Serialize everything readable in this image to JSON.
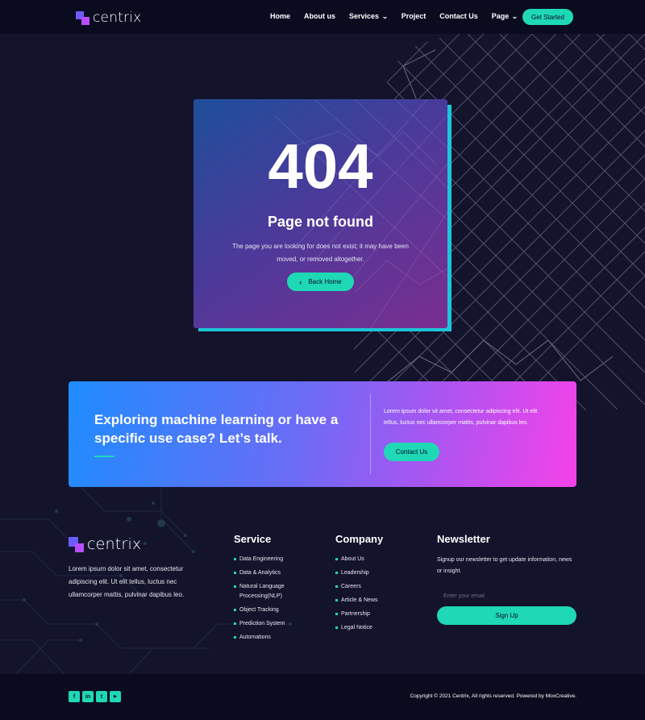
{
  "header": {
    "logo_text": "centrix",
    "nav": [
      {
        "label": "Home",
        "has_dropdown": false
      },
      {
        "label": "About us",
        "has_dropdown": false
      },
      {
        "label": "Services",
        "has_dropdown": true
      },
      {
        "label": "Project",
        "has_dropdown": false
      },
      {
        "label": "Contact Us",
        "has_dropdown": false
      },
      {
        "label": "Page",
        "has_dropdown": true
      }
    ],
    "cta_label": "Get Started"
  },
  "error_card": {
    "code": "404",
    "title": "Page not found",
    "message": "The page you are looking for does not exist; it may have been moved, or removed altogether.",
    "button_label": "Back Home",
    "button_icon": "chevron-left-icon"
  },
  "cta_band": {
    "heading": "Exploring machine learning or have a specific use case? Let’s talk.",
    "text": "Lorem ipsum dolor sit amet, consectetur adipiscing elit. Ut elit tellus, luctus nec ullamcorper mattis, pulvinar dapibus leo.",
    "button_label": "Contact Us"
  },
  "footer": {
    "logo_text": "centrix",
    "about": "Lorem ipsum dolor sit amet, consectetur adipiscing elit. Ut elit tellus, luctus nec ullamcorper mattis, pulvinar dapibus leo.",
    "service": {
      "title": "Service",
      "items": [
        "Data Engineering",
        "Data & Analytics",
        "Natural Language Processing(NLP)",
        "Object Tracking",
        "Prediction System",
        "Automations"
      ]
    },
    "company": {
      "title": "Company",
      "items": [
        "About Us",
        "Leadership",
        "Careers",
        "Article & News",
        "Partnership",
        "Legal Notice"
      ]
    },
    "newsletter": {
      "title": "Newsletter",
      "text": "Signup our newsletter to get update information, news or insight.",
      "input_placeholder": "Enter your email",
      "button_label": "Sign Up"
    }
  },
  "bottom_bar": {
    "socials": [
      {
        "icon": "facebook-icon",
        "glyph": "f"
      },
      {
        "icon": "linkedin-icon",
        "glyph": "in"
      },
      {
        "icon": "twitter-icon",
        "glyph": "t"
      },
      {
        "icon": "youtube-icon",
        "glyph": "▶"
      }
    ],
    "copyright": "Copyright © 2021 Centrix, All rights reserved. Powered by MoxCreative."
  },
  "colors": {
    "accent": "#1fd8b6",
    "background": "#13132b",
    "header_bg": "#0b0b1f",
    "logo_primary": "#6b5cff",
    "logo_secondary": "#b84dff"
  }
}
